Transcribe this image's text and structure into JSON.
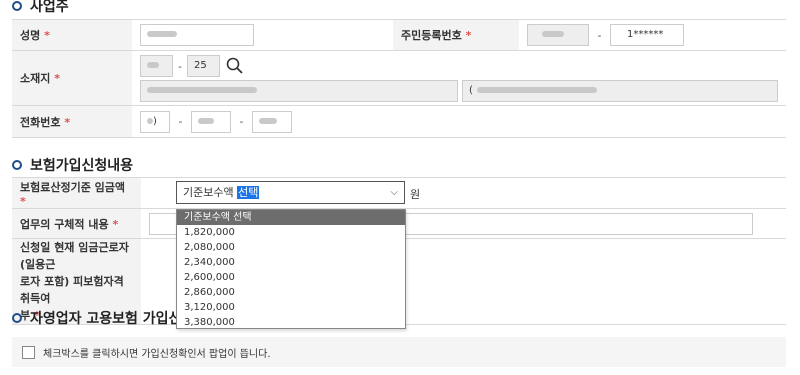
{
  "business_owner": {
    "section_title": "사업주",
    "name_label": "성명",
    "resident_number_label": "주민등록번호",
    "resident_number_suffix": "1******",
    "address_label": "소재지",
    "postal_code_part": "25",
    "address_detail_prefix": "(",
    "phone_label": "전화번호",
    "phone_part1_suffix": ")",
    "required_mark": "*",
    "dash": "-"
  },
  "insurance": {
    "section_title": "보험가입신청내용",
    "wage_label": "보험료산정기준 임금액",
    "wage_selected_plain": "기준보수액 ",
    "wage_selected_highlight": "선택",
    "wage_unit": "원",
    "job_detail_label": "업무의 구체적 내용",
    "employee_question_label_line1": "신청일 현재 임금근로자(일용근",
    "employee_question_label_line2": "로자 포함) 피보험자격 취득여",
    "employee_question_label_line3": "부",
    "wage_options": [
      "기준보수액 선택",
      "1,820,000",
      "2,080,000",
      "2,340,000",
      "2,600,000",
      "2,860,000",
      "3,120,000",
      "3,380,000"
    ]
  },
  "self_employed": {
    "section_title_visible": "자영업자 고용보험 가입신",
    "checkbox_text": "체크박스를 클릭하시면 가입신청확인서 팝업이 뜹니다."
  },
  "colors": {
    "accent": "#1f4e8c",
    "required": "#d9534f",
    "highlight": "#1a73e8"
  },
  "icons": {
    "search": "search-icon",
    "chevron": "chevron-down-icon",
    "bullet": "circle-bullet-icon"
  }
}
